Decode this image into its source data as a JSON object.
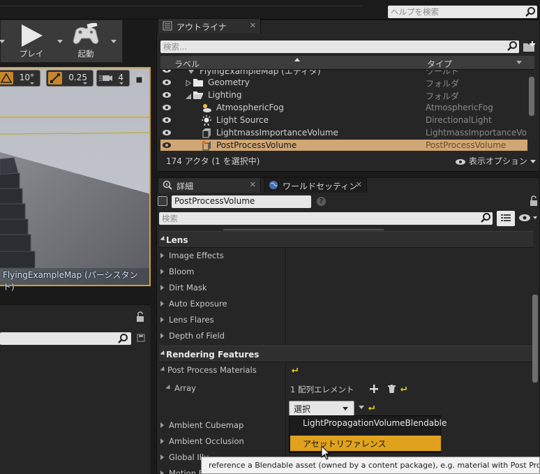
{
  "top": {
    "help_search_placeholder": "ヘルプを検索"
  },
  "toolbar": {
    "play_label": "プレイ",
    "launch_label": "起動"
  },
  "viewport": {
    "snap_rotation": "10°",
    "snap_scale": "0.25",
    "camera_speed": "4",
    "map_label": "FlyingExampleMap (パーシスタント)"
  },
  "outliner": {
    "tab_label": "アウトライナ",
    "search_placeholder": "検索...",
    "col_label": "ラベル",
    "col_type": "タイプ",
    "rows": [
      {
        "name": "FlyingExampleMap (エディタ)",
        "type": "ワールド"
      },
      {
        "name": "Geometry",
        "type": "フォルダ"
      },
      {
        "name": "Lighting",
        "type": "フォルダ"
      },
      {
        "name": "AtmosphericFog",
        "type": "AtmosphericFog"
      },
      {
        "name": "Light Source",
        "type": "DirectionalLight"
      },
      {
        "name": "LightmassImportanceVolume",
        "type": "LightmassImportanceVolume"
      },
      {
        "name": "PostProcessVolume",
        "type": "PostProcessVolume"
      }
    ],
    "status": "174 アクタ (1 を選択中)",
    "view_options": "表示オプション"
  },
  "details": {
    "tab_label": "詳細",
    "world_tab_label": "ワールドセッティン",
    "actor_name": "PostProcessVolume",
    "search_placeholder": "検索",
    "lens_header": "Lens",
    "lens_props": [
      "Image Effects",
      "Bloom",
      "Dirt Mask",
      "Auto Exposure",
      "Lens Flares",
      "Depth of Field"
    ],
    "rendering_header": "Rendering Features",
    "post_process_materials": "Post Process Materials",
    "array_label": "Array",
    "array_count": "1 配列エレメント",
    "select_label": "選択",
    "props_after": [
      "Ambient Cubemap",
      "Ambient Occlusion",
      "Global Illu",
      "Motion B"
    ]
  },
  "dropdown": {
    "items": [
      "LightPropagationVolumeBlendable",
      "アセットリファレンス"
    ]
  },
  "tooltip": {
    "text": "reference a Blendable asset (owned by a content package), e.g. material with Post Process domain"
  },
  "colors": {
    "selection": "#cfa674",
    "highlight": "#e0a21c",
    "accent_frame": "#d89d32"
  }
}
